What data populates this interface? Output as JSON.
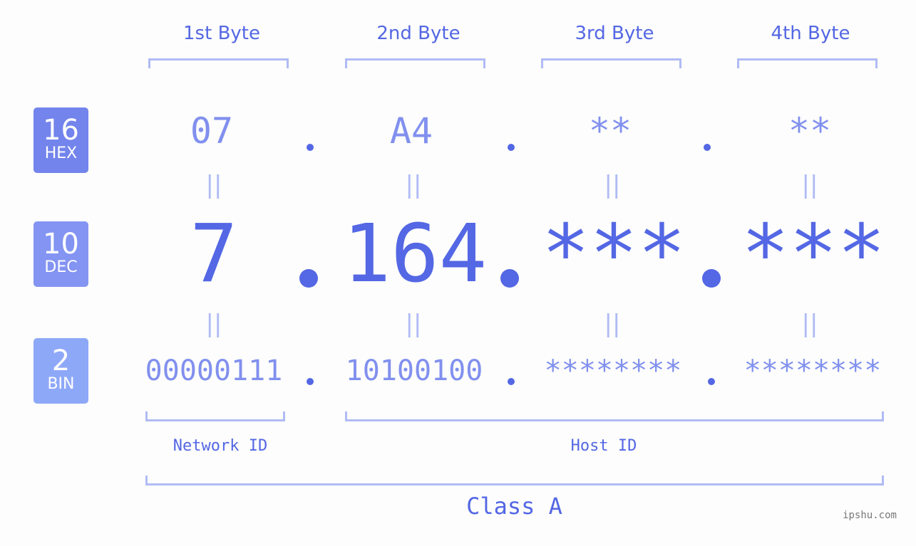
{
  "colors": {
    "hex_badge": "#7384ec",
    "dec_badge": "#8394f2",
    "bin_badge": "#8ea8f8",
    "accent": "#5467e4",
    "light_text": "#8190ee",
    "bracket": "#b0bbf5"
  },
  "badges": [
    {
      "number": "16",
      "label": "HEX"
    },
    {
      "number": "10",
      "label": "DEC"
    },
    {
      "number": "2",
      "label": "BIN"
    }
  ],
  "byte_headers": [
    "1st Byte",
    "2nd Byte",
    "3rd Byte",
    "4th Byte"
  ],
  "hex": [
    "07",
    "A4",
    "**",
    "**"
  ],
  "dec": [
    "7",
    "164",
    "***",
    "***"
  ],
  "bin": [
    "00000111",
    "10100100",
    "********",
    "********"
  ],
  "equals_symbol": "||",
  "network_id_label": "Network ID",
  "host_id_label": "Host ID",
  "class_label": "Class A",
  "watermark": "ipshu.com"
}
